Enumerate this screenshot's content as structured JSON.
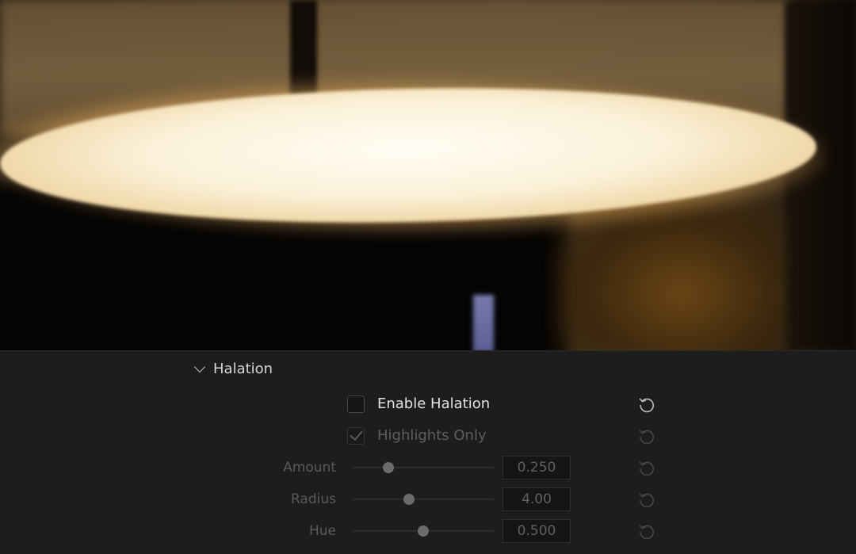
{
  "section": {
    "title": "Halation",
    "expanded": true
  },
  "checkboxes": [
    {
      "label": "Enable Halation",
      "checked": false,
      "enabled": true
    },
    {
      "label": "Highlights Only",
      "checked": true,
      "enabled": false
    }
  ],
  "params": [
    {
      "label": "Amount",
      "value": "0.250",
      "slider_fraction": 0.25
    },
    {
      "label": "Radius",
      "value": "4.00",
      "slider_fraction": 0.4
    },
    {
      "label": "Hue",
      "value": "0.500",
      "slider_fraction": 0.5
    }
  ],
  "icons": {
    "reset": "reset-icon",
    "chevron": "chevron-down-icon"
  },
  "colors": {
    "panel_bg": "#1d1d1d",
    "text_bright": "#e2e2e2",
    "text_dim": "#5e5e5e"
  }
}
